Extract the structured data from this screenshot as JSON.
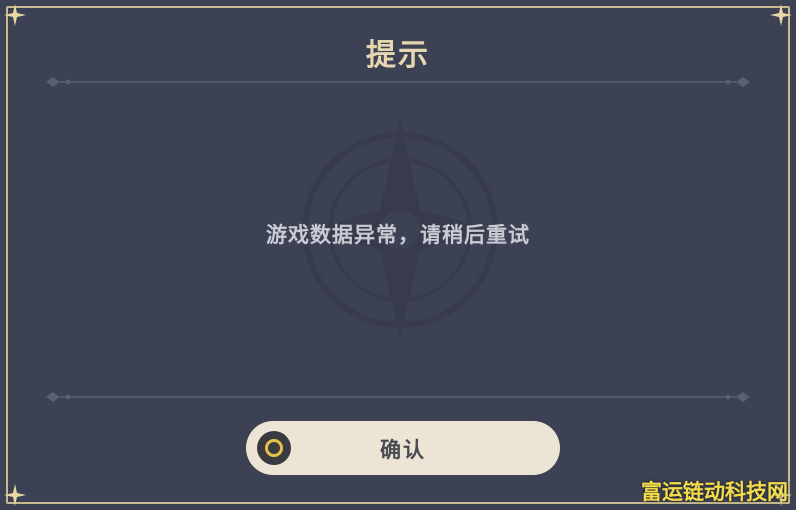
{
  "dialog": {
    "title": "提示",
    "message": "游戏数据异常，请稍后重试",
    "confirm_label": "确认",
    "confirm_button_icon": "circle-button-icon"
  },
  "watermark": {
    "text": "富运链动科技网"
  },
  "colors": {
    "background": "#3d4154",
    "title": "#e6d6b0",
    "message": "#c9cbd4",
    "button_bg": "#ece5d6",
    "button_icon_ring": "#e6c14a",
    "frame": "#c9b98e",
    "watermark": "#f2dc4a"
  }
}
